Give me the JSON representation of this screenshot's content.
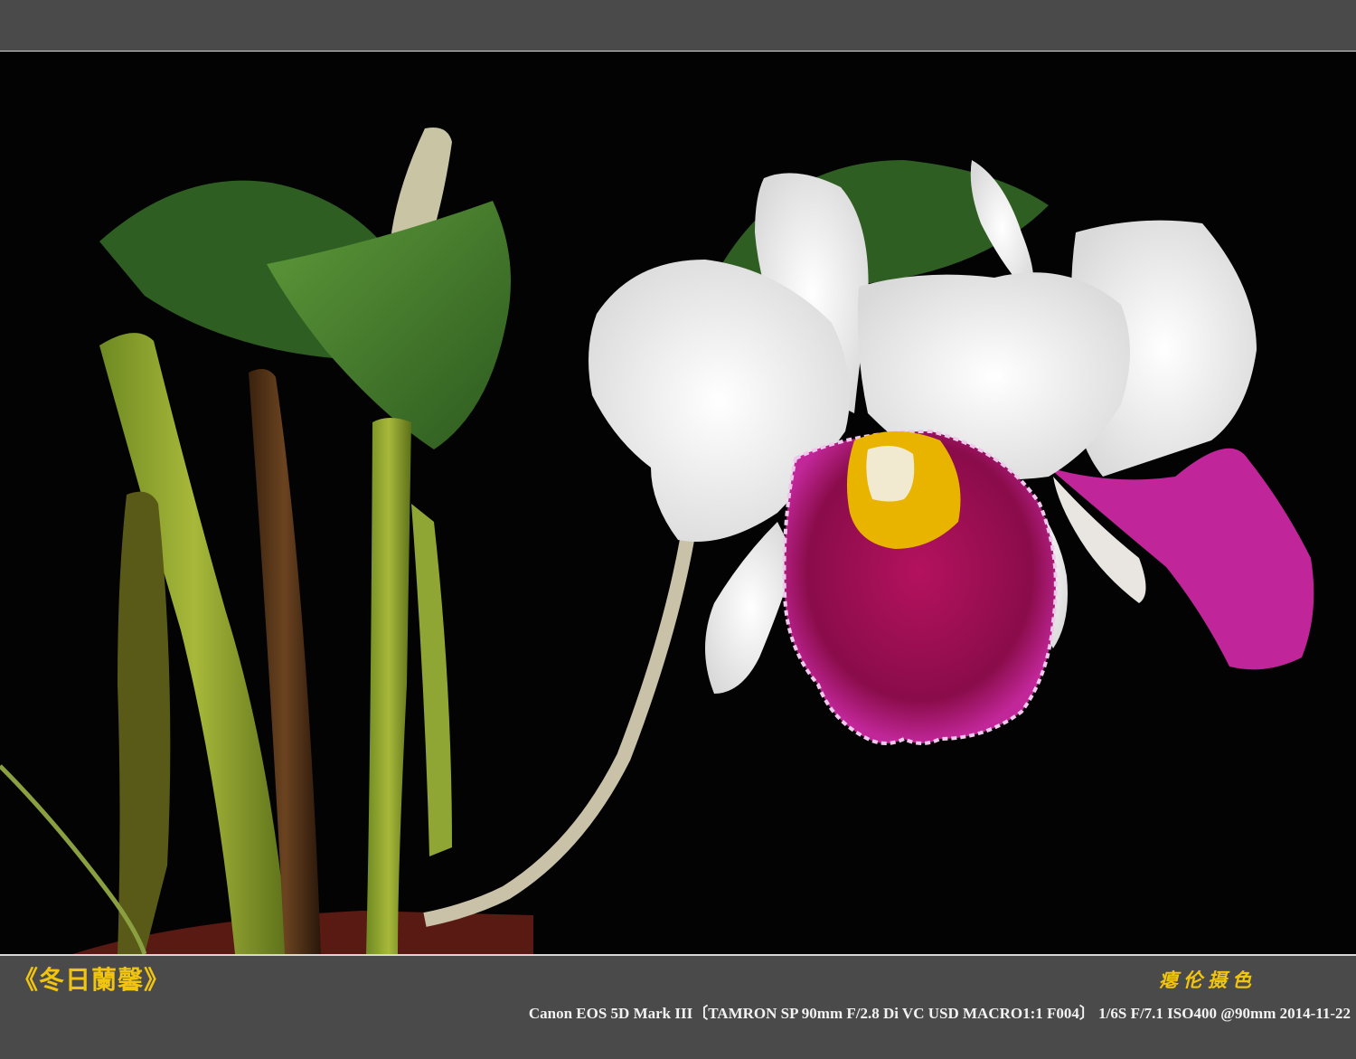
{
  "caption": {
    "title": "《冬日蘭馨》",
    "signature": "瘪伦摄色",
    "exif": "Canon EOS 5D Mark III〔TAMRON SP 90mm F/2.8 Di VC USD MACRO1:1 F004〕 1/6S F/7.1 ISO400 @90mm 2014-11-22"
  },
  "colors": {
    "frame": "#4a4a4a",
    "background": "#030303",
    "title_text": "#f1c40f",
    "exif_text": "#f2f2f2",
    "petal": "#f4f4f4",
    "lip": "#a0105a",
    "throat": "#e8b400",
    "leaf": "#3f7a2a"
  },
  "photo": {
    "subject": "white cattleya orchid with magenta lip",
    "icon": "photo-image"
  }
}
